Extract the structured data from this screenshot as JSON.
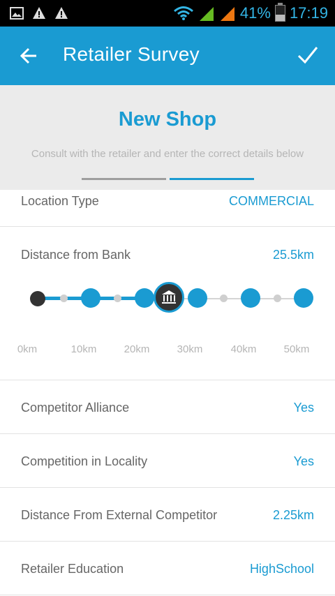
{
  "status_bar": {
    "battery": "41%",
    "time": "17:19"
  },
  "app_bar": {
    "title": "Retailer Survey"
  },
  "header": {
    "title": "New Shop",
    "subtitle": "Consult with the retailer and enter the correct details below",
    "tabs_total": 2,
    "active_tab_index": 1
  },
  "form": {
    "location_type": {
      "label": "Location Type",
      "value": "COMMERCIAL"
    },
    "distance_from_bank": {
      "label": "Distance from Bank",
      "value": "25.5km",
      "slider_level": 0.51,
      "tick_labels": [
        "0km",
        "10km",
        "20km",
        "30km",
        "40km",
        "50km"
      ]
    },
    "competitor_alliance": {
      "label": "Competitor Alliance",
      "value": "Yes"
    },
    "competition_in_locality": {
      "label": "Competition in Locality",
      "value": "Yes"
    },
    "distance_external_competitor": {
      "label": "Distance From External Competitor",
      "value": "2.25km"
    },
    "retailer_education": {
      "label": "Retailer Education",
      "value": "HighSchool"
    }
  },
  "colors": {
    "accent": "#1a9bd2",
    "header_bg": "#ebebeb"
  },
  "icons": {
    "back": "arrow-left-icon",
    "confirm": "check-icon",
    "slider_thumb": "bank-icon"
  }
}
